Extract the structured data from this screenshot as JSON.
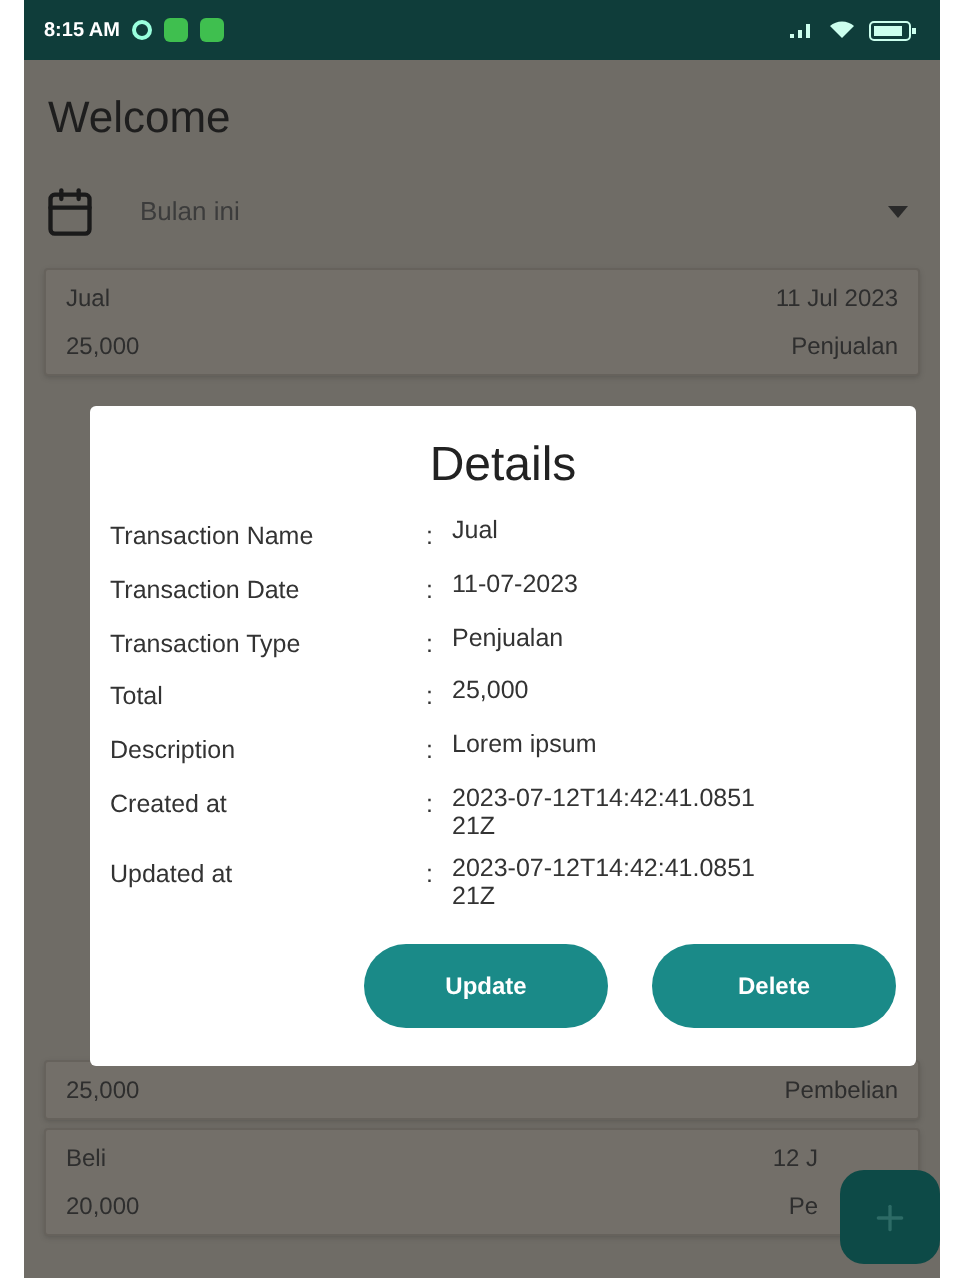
{
  "status_bar": {
    "time": "8:15 AM"
  },
  "header": {
    "title": "Welcome"
  },
  "filter": {
    "value": "Bulan ini"
  },
  "transactions": [
    {
      "kind": "full",
      "name": "Jual",
      "date": "11 Jul 2023",
      "total": "25,000",
      "type": "Penjualan"
    },
    {
      "kind": "partial",
      "total": "25,000",
      "type": "Pembelian"
    },
    {
      "kind": "full",
      "name": "Beli",
      "date": "12 J",
      "total": "20,000",
      "type": "Pe"
    }
  ],
  "dialog": {
    "title": "Details",
    "rows": [
      {
        "label": "Transaction Name",
        "separator": ":",
        "value": "Jual"
      },
      {
        "label": "Transaction Date",
        "separator": ":",
        "value": "11-07-2023"
      },
      {
        "label": "Transaction Type",
        "separator": ":",
        "value": "Penjualan"
      },
      {
        "label": "Total",
        "separator": ":",
        "value": "25,000"
      },
      {
        "label": "Description",
        "separator": ":",
        "value": "Lorem ipsum"
      },
      {
        "label": "Created at",
        "separator": ":",
        "value": "2023-07-12T14:42:41.085121Z"
      },
      {
        "label": "Updated at",
        "separator": ":",
        "value": "2023-07-12T14:42:41.085121Z"
      }
    ],
    "buttons": [
      "Update",
      "Delete"
    ]
  }
}
